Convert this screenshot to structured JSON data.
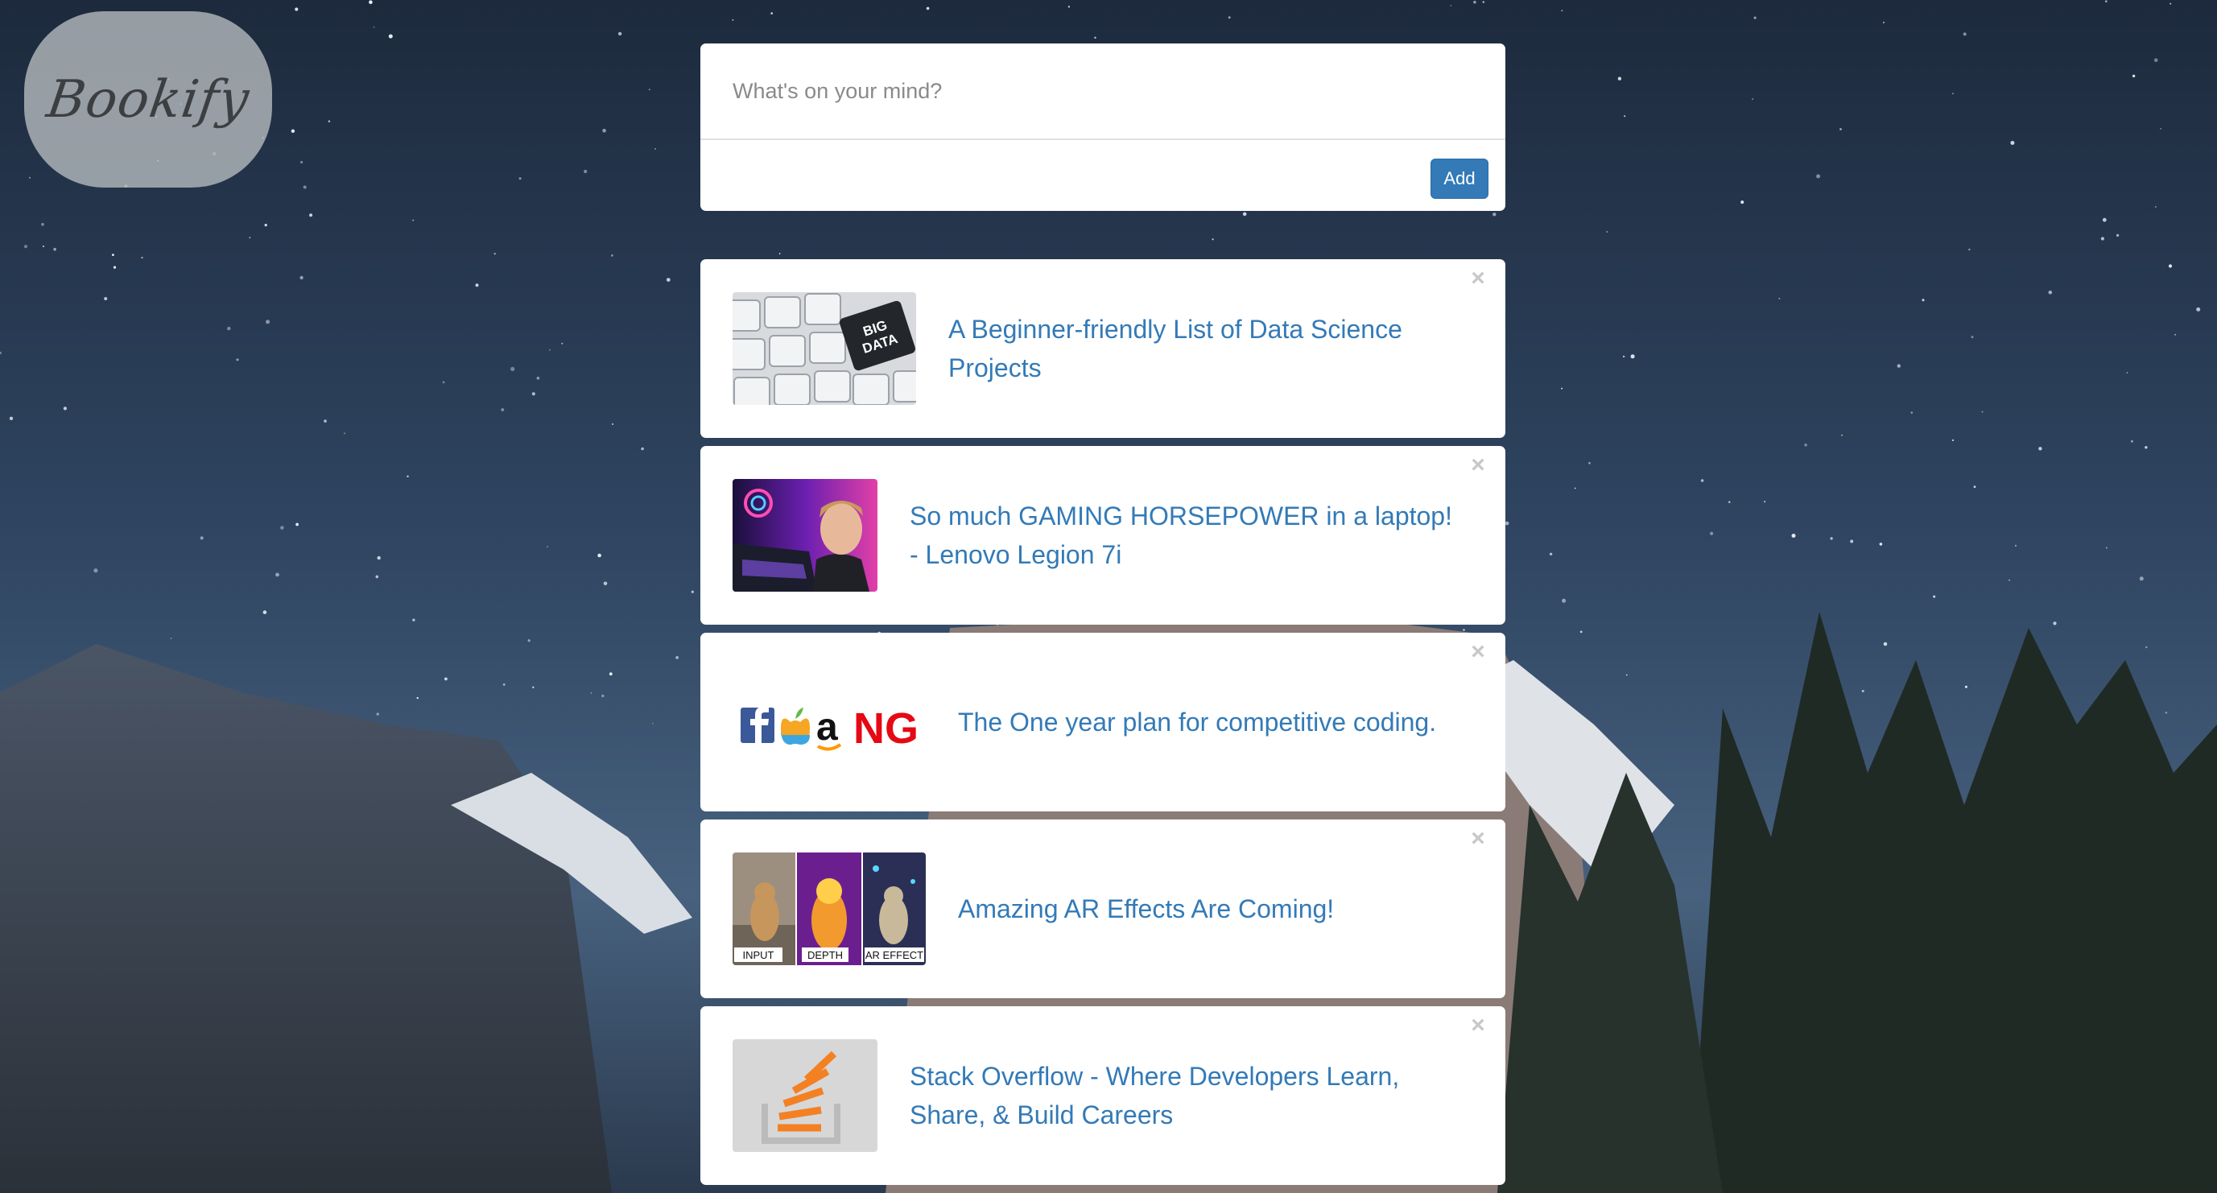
{
  "logo": {
    "text": "Bookify"
  },
  "composer": {
    "placeholder": "What's on your mind?",
    "add_label": "Add"
  },
  "posts": [
    {
      "title": "A Beginner-friendly List of Data Science Projects",
      "thumb_text": [
        "BIG",
        "DATA"
      ]
    },
    {
      "title": "So much GAMING HORSEPOWER in a laptop! - Lenovo Legion 7i"
    },
    {
      "title": "The One year plan for competitive coding.",
      "thumb_text": [
        "a",
        "NG"
      ]
    },
    {
      "title": "Amazing AR Effects Are Coming!",
      "thumb_text": [
        "INPUT",
        "DEPTH",
        "AR EFFECT"
      ]
    },
    {
      "title": "Stack Overflow - Where Developers Learn, Share, & Build Careers"
    }
  ],
  "close_glyph": "×",
  "colors": {
    "link": "#337ab7",
    "button": "#337ab7",
    "close": "#c8c8c8"
  }
}
